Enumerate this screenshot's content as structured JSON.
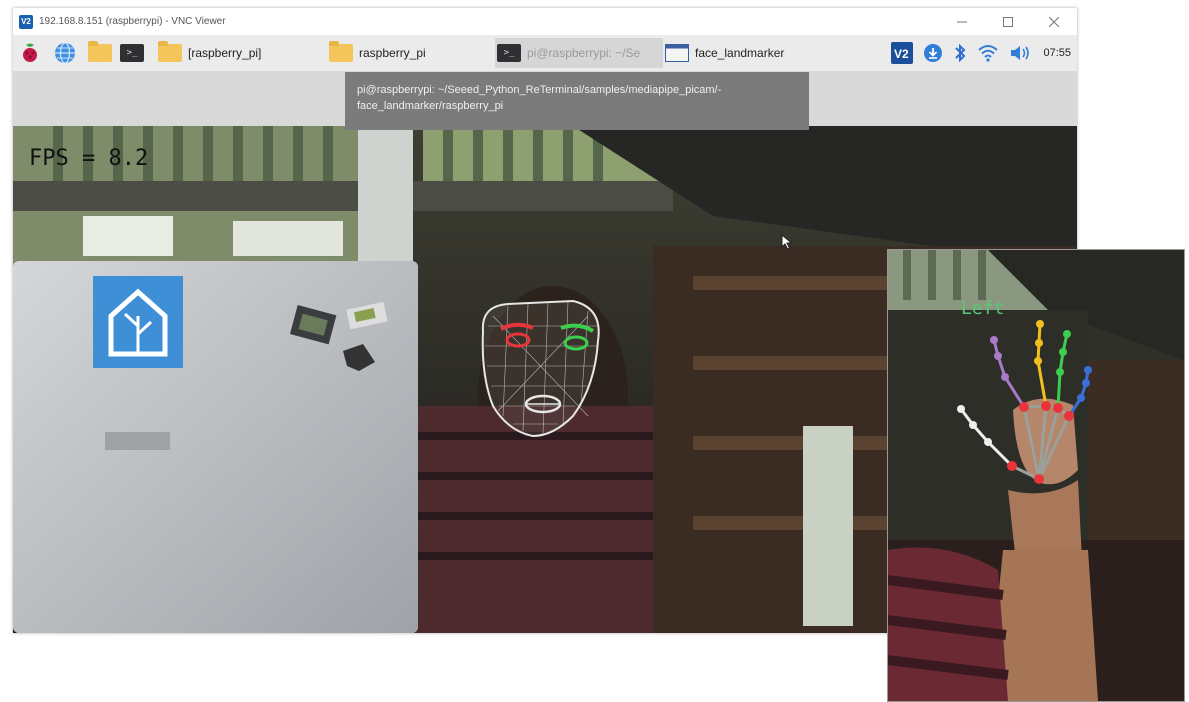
{
  "window": {
    "title": "192.168.8.151 (raspberrypi) - VNC Viewer",
    "logo": "V2",
    "minimize_icon": "minimize-icon",
    "maximize_icon": "maximize-icon",
    "close_icon": "close-icon"
  },
  "taskbar": {
    "launchers": [
      "raspberry-menu-icon",
      "browser-globe-icon",
      "file-manager-icon",
      "terminal-icon"
    ],
    "tasks": [
      {
        "label": "[raspberry_pi]",
        "icon": "folder-icon"
      },
      {
        "label": "raspberry_pi",
        "icon": "folder-icon"
      },
      {
        "label": "pi@raspberrypi: ~/Se",
        "icon": "terminal-icon"
      },
      {
        "label": "face_landmarker",
        "icon": "window-icon"
      }
    ],
    "tray": [
      "vnc-icon",
      "download-icon",
      "bluetooth-icon",
      "wifi-icon",
      "volume-icon"
    ],
    "clock": "07:55"
  },
  "tooltip": {
    "line1": "pi@raspberrypi: ~/Seeed_Python_ReTerminal/samples/mediapipe_picam/-",
    "line2": "face_landmarker/raspberry_pi"
  },
  "camera": {
    "fps_text": "FPS = 8.2"
  },
  "hand_inset": {
    "handedness_label": "Left"
  },
  "colors": {
    "taskbar_bg": "#ebebeb",
    "tooltip_bg": "#7b7b7b",
    "landmark_red": "#e8343b",
    "landmark_green": "#3ccf4e",
    "landmark_yellow": "#f0c020",
    "landmark_blue": "#3a6fd8",
    "landmark_purple": "#a77bc8",
    "mesh_white": "#e6e6e6"
  }
}
